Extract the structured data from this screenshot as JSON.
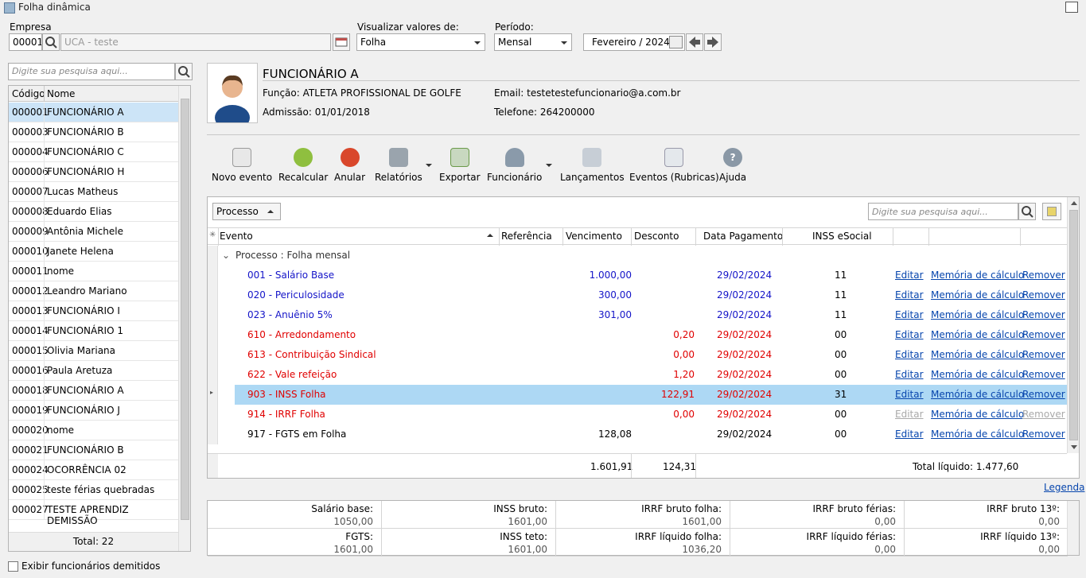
{
  "window": {
    "title": "Folha dinâmica"
  },
  "top": {
    "empresa_label": "Empresa",
    "empresa_code": "00001",
    "empresa_name": "UCA - teste",
    "visualizar_label": "Visualizar valores de:",
    "visualizar_value": "Folha",
    "periodo_label": "Período:",
    "periodo_value": "Mensal",
    "periodo_date": "Fevereiro / 2024"
  },
  "sidebar": {
    "search_placeholder": "Digite sua pesquisa aqui...",
    "col_codigo": "Código",
    "col_nome": "Nome",
    "rows": [
      {
        "code": "000001",
        "name": "FUNCIONÁRIO A"
      },
      {
        "code": "000003",
        "name": "FUNCIONÁRIO B"
      },
      {
        "code": "000004",
        "name": "FUNCIONÁRIO C"
      },
      {
        "code": "000006",
        "name": "FUNCIONÁRIO H"
      },
      {
        "code": "000007",
        "name": "Lucas Matheus"
      },
      {
        "code": "000008",
        "name": "Eduardo Elias"
      },
      {
        "code": "000009",
        "name": "Antônia Michele"
      },
      {
        "code": "000010",
        "name": "Janete Helena"
      },
      {
        "code": "000011",
        "name": "nome"
      },
      {
        "code": "000012",
        "name": "Leandro Mariano"
      },
      {
        "code": "000013",
        "name": "FUNCIONÁRIO I"
      },
      {
        "code": "000014",
        "name": "FUNCIONÁRIO 1"
      },
      {
        "code": "000015",
        "name": "Olivia Mariana"
      },
      {
        "code": "000016",
        "name": "Paula Aretuza"
      },
      {
        "code": "000018",
        "name": "FUNCIONÁRIO A"
      },
      {
        "code": "000019",
        "name": "FUNCIONÁRIO J"
      },
      {
        "code": "000020",
        "name": "nome"
      },
      {
        "code": "000021",
        "name": "FUNCIONÁRIO B"
      },
      {
        "code": "000024",
        "name": "OCORRÊNCIA 02"
      },
      {
        "code": "000025",
        "name": "teste férias quebradas"
      },
      {
        "code": "000027",
        "name": "TESTE APRENDIZ DEMISSÃO"
      }
    ],
    "total": "Total: 22",
    "show_dismissed": "Exibir funcionários demitidos"
  },
  "employee": {
    "name": "FUNCIONÁRIO A",
    "funcao_label": "Função:",
    "funcao": "ATLETA PROFISSIONAL DE GOLFE",
    "admissao_label": "Admissão:",
    "admissao": "01/01/2018",
    "email_label": "Email:",
    "email": "testetestefuncionario@a.com.br",
    "telefone_label": "Telefone:",
    "telefone": "264200000"
  },
  "toolbar": {
    "novo": "Novo evento",
    "recalcular": "Recalcular",
    "anular": "Anular",
    "relatorios": "Relatórios",
    "exportar": "Exportar",
    "funcionario": "Funcionário",
    "lancamentos": "Lançamentos",
    "eventos": "Eventos (Rubricas)",
    "ajuda": "Ajuda"
  },
  "grid": {
    "group_by": "Processo",
    "search_placeholder": "Digite sua pesquisa aqui...",
    "columns": {
      "evento": "Evento",
      "referencia": "Referência",
      "vencimento": "Vencimento",
      "desconto": "Desconto",
      "data": "Data Pagamento",
      "inss": "INSS eSocial"
    },
    "group_label": "Processo : Folha mensal",
    "rows": [
      {
        "evento": "001 - Salário Base",
        "venc": "1.000,00",
        "desc": "",
        "data": "29/02/2024",
        "inss": "11",
        "edit": "Editar",
        "mem": "Memória de cálculo",
        "rem": "Remover"
      },
      {
        "evento": "020 - Periculosidade",
        "venc": "300,00",
        "desc": "",
        "data": "29/02/2024",
        "inss": "11",
        "edit": "Editar",
        "mem": "Memória de cálculo",
        "rem": "Remover"
      },
      {
        "evento": "023 - Anuênio 5%",
        "venc": "301,00",
        "desc": "",
        "data": "29/02/2024",
        "inss": "11",
        "edit": "Editar",
        "mem": "Memória de cálculo",
        "rem": "Remover"
      },
      {
        "evento": "610 - Arredondamento",
        "venc": "",
        "desc": "0,20",
        "data": "29/02/2024",
        "inss": "00",
        "edit": "Editar",
        "mem": "Memória de cálculo",
        "rem": "Remover"
      },
      {
        "evento": "613 - Contribuição Sindical",
        "venc": "",
        "desc": "0,00",
        "data": "29/02/2024",
        "inss": "00",
        "edit": "Editar",
        "mem": "Memória de cálculo",
        "rem": "Remover"
      },
      {
        "evento": "622 - Vale refeição",
        "venc": "",
        "desc": "1,20",
        "data": "29/02/2024",
        "inss": "00",
        "edit": "Editar",
        "mem": "Memória de cálculo",
        "rem": "Remover"
      },
      {
        "evento": "903 - INSS Folha",
        "venc": "",
        "desc": "122,91",
        "data": "29/02/2024",
        "inss": "31",
        "edit": "Editar",
        "mem": "Memória de cálculo",
        "rem": "Remover"
      },
      {
        "evento": "914 - IRRF Folha",
        "venc": "",
        "desc": "0,00",
        "data": "29/02/2024",
        "inss": "00",
        "edit": "Editar",
        "mem": "Memória de cálculo",
        "rem": "Remover"
      },
      {
        "evento": "917 - FGTS em Folha",
        "venc": "128,08",
        "desc": "",
        "data": "29/02/2024",
        "inss": "00",
        "edit": "Editar",
        "mem": "Memória de cálculo",
        "rem": "Remover"
      }
    ],
    "total_venc": "1.601,91",
    "total_desc": "124,31",
    "total_liquido": "Total líquido: 1.477,60",
    "legenda": "Legenda"
  },
  "summary": [
    {
      "k": "Salário base:",
      "v": "1050,00"
    },
    {
      "k": "INSS bruto:",
      "v": "1601,00"
    },
    {
      "k": "IRRF bruto folha:",
      "v": "1601,00"
    },
    {
      "k": "IRRF bruto férias:",
      "v": "0,00"
    },
    {
      "k": "IRRF bruto 13º:",
      "v": "0,00"
    },
    {
      "k": "FGTS:",
      "v": "1601,00"
    },
    {
      "k": "INSS teto:",
      "v": "1601,00"
    },
    {
      "k": "IRRF líquido folha:",
      "v": "1036,20"
    },
    {
      "k": "IRRF líquido férias:",
      "v": "0,00"
    },
    {
      "k": "IRRF líquido 13º:",
      "v": "0,00"
    }
  ]
}
